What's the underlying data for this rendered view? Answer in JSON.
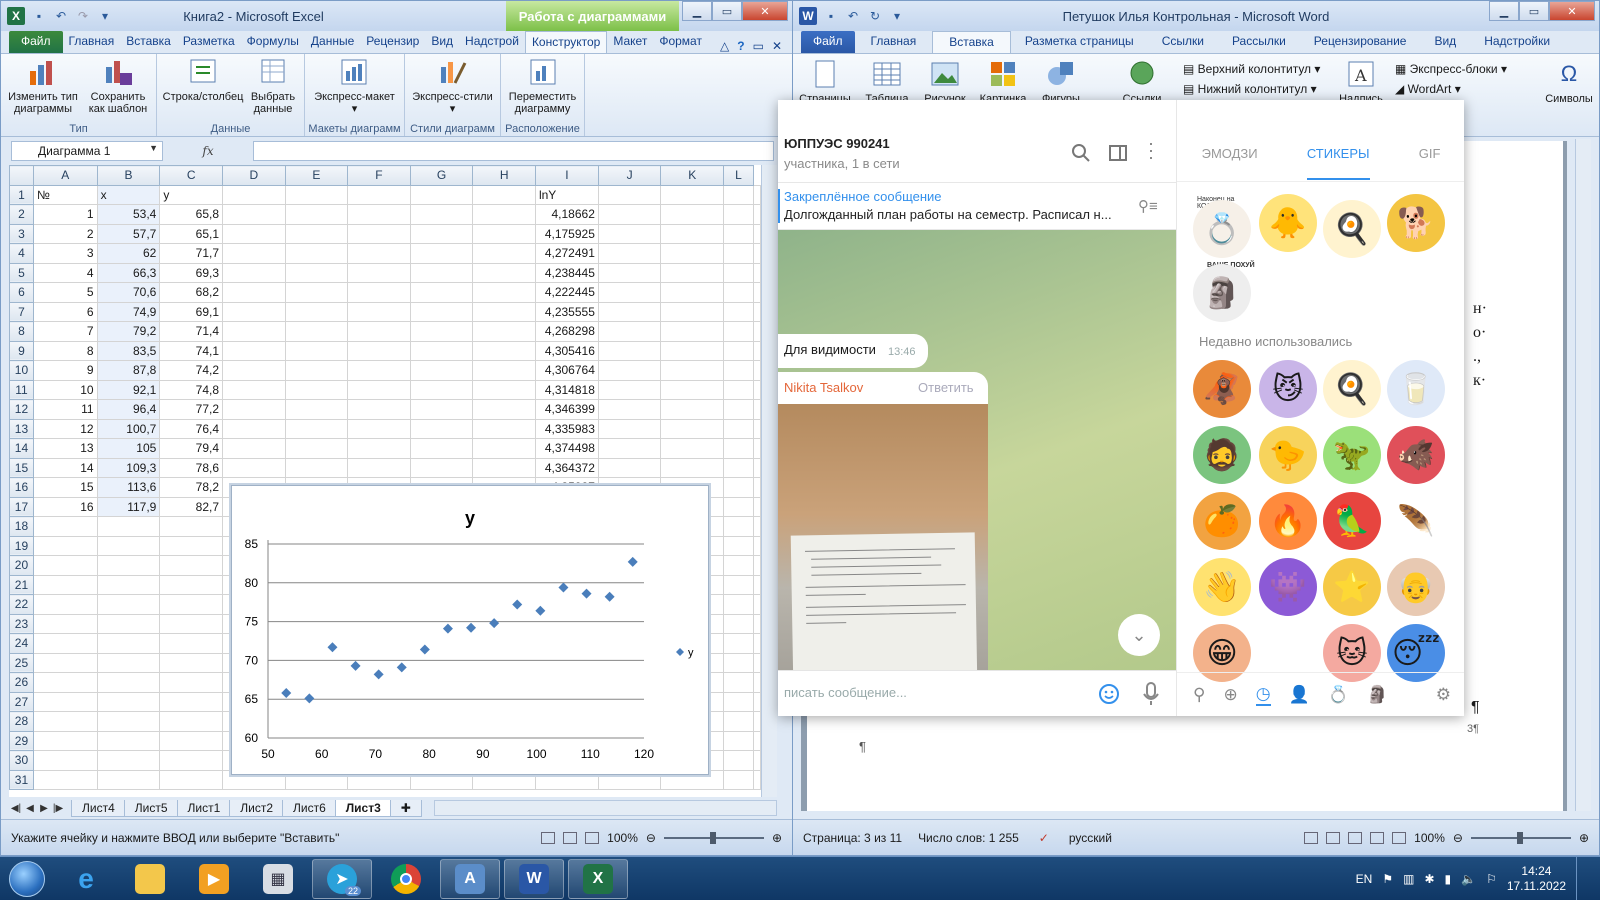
{
  "excel": {
    "title": "Книга2 - Microsoft Excel",
    "context_tab_header": "Работа с диаграммами",
    "tabs": [
      "Файл",
      "Главная",
      "Вставка",
      "Разметка",
      "Формулы",
      "Данные",
      "Рецензир",
      "Вид",
      "Надстрой",
      "Конструктор",
      "Макет",
      "Формат"
    ],
    "ribbon": {
      "groups": [
        {
          "label": "Тип",
          "buttons": [
            "Изменить тип диаграммы",
            "Сохранить как шаблон"
          ]
        },
        {
          "label": "Данные",
          "buttons": [
            "Строка/столбец",
            "Выбрать данные"
          ]
        },
        {
          "label": "Макеты диаграмм",
          "buttons": [
            "Экспресс-макет"
          ]
        },
        {
          "label": "Стили диаграмм",
          "buttons": [
            "Экспресс-стили"
          ]
        },
        {
          "label": "Расположение",
          "buttons": [
            "Переместить диаграмму"
          ]
        }
      ]
    },
    "name_box": "Диаграмма 1",
    "fx": "fx",
    "columns": [
      "A",
      "B",
      "C",
      "D",
      "E",
      "F",
      "G",
      "H",
      "I",
      "J",
      "K",
      "L"
    ],
    "header_row": {
      "A": "№",
      "B": "x",
      "C": "y",
      "I": "lnY"
    },
    "rows": [
      {
        "n": "1",
        "x": "53,4",
        "y": "65,8",
        "ln": "4,18662"
      },
      {
        "n": "2",
        "x": "57,7",
        "y": "65,1",
        "ln": "4,175925"
      },
      {
        "n": "3",
        "x": "62",
        "y": "71,7",
        "ln": "4,272491"
      },
      {
        "n": "4",
        "x": "66,3",
        "y": "69,3",
        "ln": "4,238445"
      },
      {
        "n": "5",
        "x": "70,6",
        "y": "68,2",
        "ln": "4,222445"
      },
      {
        "n": "6",
        "x": "74,9",
        "y": "69,1",
        "ln": "4,235555"
      },
      {
        "n": "7",
        "x": "79,2",
        "y": "71,4",
        "ln": "4,268298"
      },
      {
        "n": "8",
        "x": "83,5",
        "y": "74,1",
        "ln": "4,305416"
      },
      {
        "n": "9",
        "x": "87,8",
        "y": "74,2",
        "ln": "4,306764"
      },
      {
        "n": "10",
        "x": "92,1",
        "y": "74,8",
        "ln": "4,314818"
      },
      {
        "n": "11",
        "x": "96,4",
        "y": "77,2",
        "ln": "4,346399"
      },
      {
        "n": "12",
        "x": "100,7",
        "y": "76,4",
        "ln": "4,335983"
      },
      {
        "n": "13",
        "x": "105",
        "y": "79,4",
        "ln": "4,374498"
      },
      {
        "n": "14",
        "x": "109,3",
        "y": "78,6",
        "ln": "4,364372"
      },
      {
        "n": "15",
        "x": "113,6",
        "y": "78,2",
        "ln": "4,35927"
      },
      {
        "n": "16",
        "x": "117,9",
        "y": "82,7",
        "ln": ""
      }
    ],
    "sheets": [
      "Лист4",
      "Лист5",
      "Лист1",
      "Лист2",
      "Лист6",
      "Лист3"
    ],
    "active_sheet": "Лист3",
    "status_text": "Укажите ячейку и нажмите ВВОД или выберите \"Вставить\"",
    "zoom": "100%"
  },
  "chart_data": {
    "type": "scatter",
    "title": "y",
    "xlabel": "",
    "ylabel": "",
    "xlim": [
      50,
      120
    ],
    "ylim": [
      60,
      85
    ],
    "xticks": [
      50,
      60,
      70,
      80,
      90,
      100,
      110,
      120
    ],
    "yticks": [
      60,
      65,
      70,
      75,
      80,
      85
    ],
    "grid": "horizontal",
    "legend": "right",
    "series": [
      {
        "name": "y",
        "color": "#4a7ebb",
        "x": [
          53.4,
          57.7,
          62,
          66.3,
          70.6,
          74.9,
          79.2,
          83.5,
          87.8,
          92.1,
          96.4,
          100.7,
          105,
          109.3,
          113.6,
          117.9
        ],
        "y": [
          65.8,
          65.1,
          71.7,
          69.3,
          68.2,
          69.1,
          71.4,
          74.1,
          74.2,
          74.8,
          77.2,
          76.4,
          79.4,
          78.6,
          78.2,
          82.7
        ]
      }
    ]
  },
  "word": {
    "title": "Петушок Илья Контрольная - Microsoft Word",
    "tabs": [
      "Файл",
      "Главная",
      "Вставка",
      "Разметка страницы",
      "Ссылки",
      "Рассылки",
      "Рецензирование",
      "Вид",
      "Надстройки"
    ],
    "ribbon_buttons": [
      "Страницы",
      "Таблица",
      "Рисунок",
      "Картинка",
      "Фигуры",
      "Ссылки",
      "Надпись",
      "Символы"
    ],
    "ribbon_small": [
      "Верхний колонтитул",
      "Нижний колонтитул",
      "Экспресс-блоки",
      "WordArt"
    ],
    "status": {
      "page": "Страница: 3 из 11",
      "words": "Число слов: 1 255",
      "lang": "русский",
      "zoom": "100%"
    },
    "pilcrow": "¶",
    "page_num": "3¶",
    "margin_text": [
      "н·",
      "о·",
      "., ",
      "к·",
      "¶"
    ]
  },
  "telegram": {
    "chat_title": "ЮППУЭС 990241",
    "chat_status": "участника, 1 в сети",
    "pinned_label": "Закреплённое сообщение",
    "pinned_text": "Долгожданный план работы на семестр.  Расписал н...",
    "msg1_text": "Для видимости",
    "msg1_time": "13:46",
    "msg2_author": "Nikita Tsalkov",
    "msg2_reply": "Ответить",
    "input_placeholder": "писать сообщение...",
    "panel_tabs": [
      "ЭМОДЗИ",
      "СТИКЕРЫ",
      "GIF"
    ],
    "active_panel_tab": "СТИКЕРЫ",
    "recent_label": "Недавно использовались",
    "sticker_caption_1": "ВАШЕ ПОХУЙ",
    "sticker_caption_0": "Наконец на КОЛЬЦЕ",
    "accent": "#3390ec"
  },
  "taskbar": {
    "items": [
      "ie",
      "explorer",
      "media",
      "calculator",
      "telegram",
      "chrome",
      "fineReader",
      "word",
      "excel"
    ],
    "telegram_badge": "22",
    "lang": "EN",
    "time": "14:24",
    "date": "17.11.2022"
  }
}
